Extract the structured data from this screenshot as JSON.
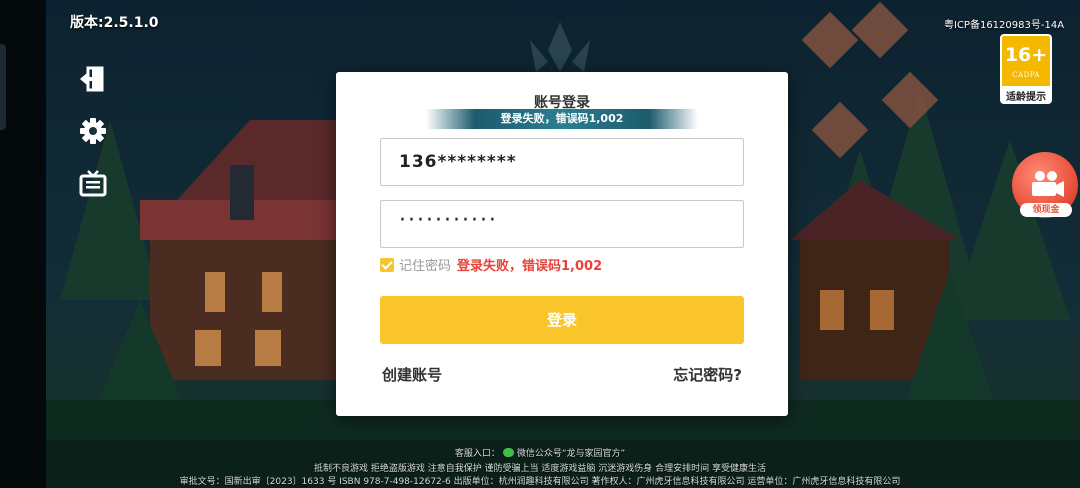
{
  "top": {
    "version": "版本:2.5.1.0",
    "icp": "粤ICP备16120983号-14A"
  },
  "age_badge": {
    "number": "16+",
    "org": "CADPA",
    "hint": "适龄提示"
  },
  "side_icons": [
    "exit-icon",
    "settings-gear-icon",
    "notice-board-icon"
  ],
  "cash_button": {
    "label": "领现金",
    "icon": "video-camera-icon"
  },
  "dialog": {
    "title": "账号登录",
    "banner": "登录失败，错误码1,002",
    "account_value": "136********",
    "password_value": "···········",
    "remember_label": "记住密码",
    "error_message": "登录失败，错误码1,002",
    "login_button": "登录",
    "create_account": "创建账号",
    "forgot_password": "忘记密码?"
  },
  "footer": {
    "service_prefix": "客服入口：",
    "service_text": "微信公众号“龙与家园官方”",
    "health_notice": "抵制不良游戏  拒绝盗版游戏  注意自我保护  谨防受骗上当  适度游戏益脑  沉迷游戏伤身  合理安排时间  享受健康生活",
    "publication_info": "审批文号：国新出审〔2023〕1633 号    ISBN 978-7-498-12672-6    出版单位：杭州润趣科技有限公司    著作权人：广州虎牙信息科技有限公司    运营单位：广州虎牙信息科技有限公司"
  },
  "colors": {
    "accent_yellow": "#f9c52a",
    "error_red": "#e8433a",
    "banner_teal": "#2a7f93"
  }
}
